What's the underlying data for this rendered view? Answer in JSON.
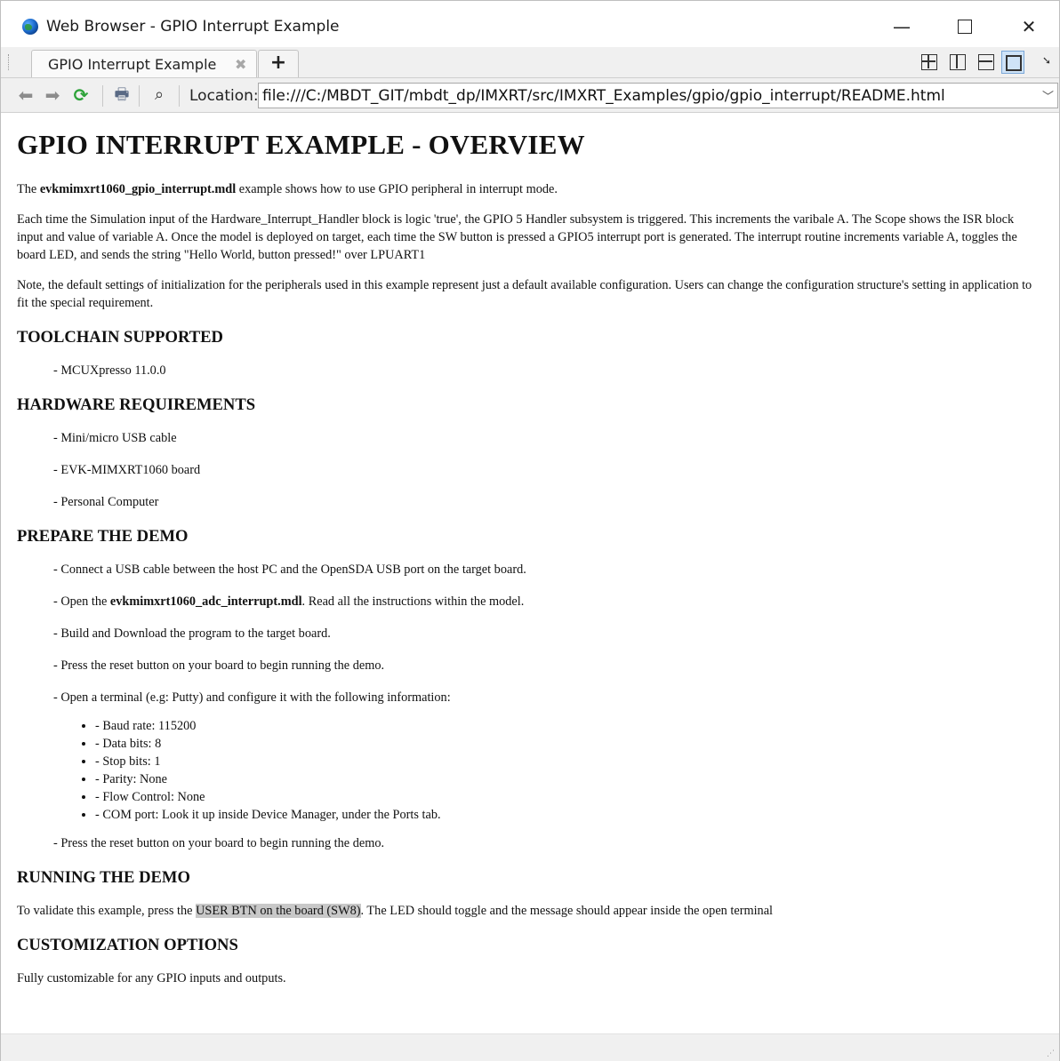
{
  "window": {
    "title": "Web Browser - GPIO Interrupt Example",
    "controls": {
      "minimize": "—",
      "close": "✕"
    }
  },
  "tabs": [
    {
      "label": "GPIO Interrupt Example",
      "close": "✖"
    }
  ],
  "new_tab_label": "+",
  "toolbar": {
    "location_label": "Location:",
    "location_value": "file:///C:/MBDT_GIT/mbdt_dp/IMXRT/src/IMXRT_Examples/gpio/gpio_interrupt/README.html"
  },
  "icons": {
    "back": "back-arrow-icon",
    "forward": "forward-arrow-icon",
    "reload": "reload-icon",
    "print": "print-icon",
    "find": "binoculars-icon"
  },
  "colors": {
    "reload": "#2ea33a",
    "highlight": "#c8c8c8",
    "active_layout": "#cfe3f7"
  },
  "page": {
    "title": "GPIO INTERRUPT EXAMPLE - OVERVIEW",
    "intro": {
      "prefix": "The ",
      "model": "evkmimxrt1060_gpio_interrupt.mdl",
      "suffix": " example shows how to use GPIO peripheral in interrupt mode."
    },
    "paragraph2": "Each time the Simulation input of the Hardware_Interrupt_Handler block is logic 'true', the GPIO 5 Handler subsystem is triggered. This increments the varibale A. The Scope shows the ISR block input and value of variable A. Once the model is deployed on target, each time the SW button is pressed a GPIO5 interrupt port is generated. The interrupt routine increments variable A, toggles the board LED, and sends the string \"Hello World, button pressed!\" over LPUART1",
    "paragraph3": "Note, the default settings of initialization for the peripherals used in this example represent just a default available configuration. Users can change the configuration structure's setting in application to fit the special requirement.",
    "toolchain": {
      "heading": "TOOLCHAIN SUPPORTED",
      "items": [
        "- MCUXpresso 11.0.0"
      ]
    },
    "hardware": {
      "heading": "HARDWARE REQUIREMENTS",
      "items": [
        "- Mini/micro USB cable",
        "- EVK-MIMXRT1060 board",
        "- Personal Computer"
      ]
    },
    "prepare": {
      "heading": "PREPARE THE DEMO",
      "step1": "- Connect a USB cable between the host PC and the OpenSDA USB port on the target board.",
      "step2_prefix": "- Open the ",
      "step2_model": "evkmimxrt1060_adc_interrupt.mdl",
      "step2_suffix": ". Read all the instructions within the model.",
      "step3": "- Build and Download the program to the target board.",
      "step4": "- Press the reset button on your board to begin running the demo.",
      "step5": "- Open a terminal (e.g: Putty) and configure it with the following information:",
      "serial": [
        "- Baud rate: 115200",
        "- Data bits: 8",
        "- Stop bits: 1",
        "- Parity: None",
        "- Flow Control: None",
        "- COM port: Look it up inside Device Manager, under the Ports tab."
      ],
      "step6": "- Press the reset button on your board to begin running the demo."
    },
    "running": {
      "heading": "RUNNING THE DEMO",
      "prefix": "To validate this example, press the ",
      "highlight": "USER BTN on the board (SW8)",
      "suffix": ". The LED should toggle and the message should appear inside the open terminal"
    },
    "customization": {
      "heading": "CUSTOMIZATION OPTIONS",
      "text": "Fully customizable for any GPIO inputs and outputs."
    }
  }
}
